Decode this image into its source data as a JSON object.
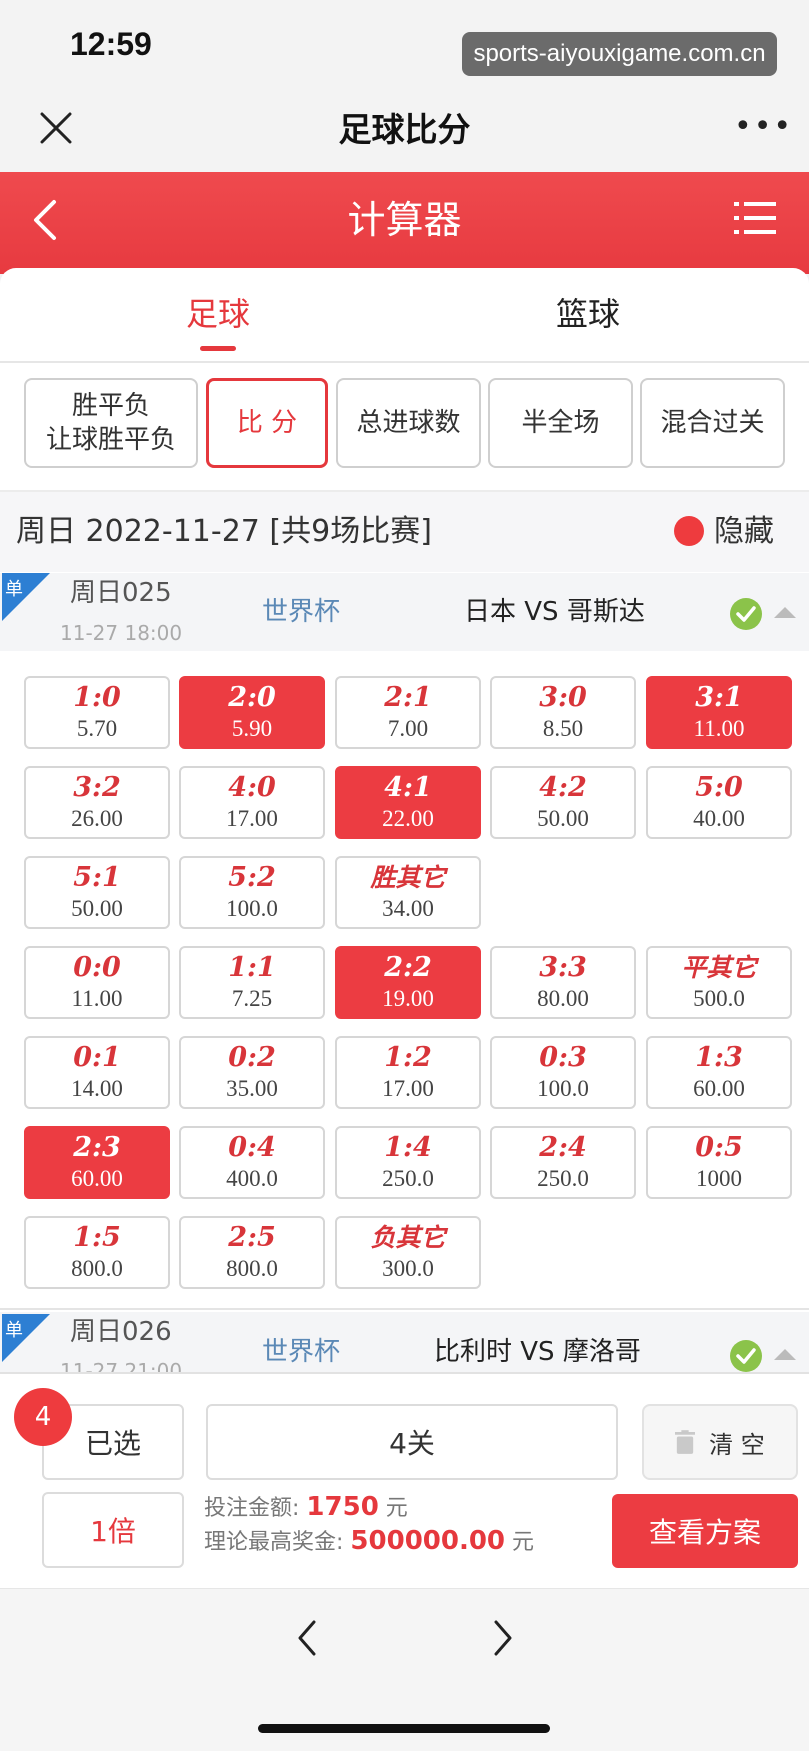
{
  "status": {
    "time": "12:59",
    "watermark": "sports-aiyouxigame.com.cn"
  },
  "wechat": {
    "title": "足球比分"
  },
  "header": {
    "title": "计算器"
  },
  "sport_tabs": [
    {
      "label": "足球",
      "active": true
    },
    {
      "label": "篮球",
      "active": false
    }
  ],
  "play_types": [
    {
      "label": "胜平负",
      "label2": "让球胜平负",
      "selected": false
    },
    {
      "label": "比 分",
      "selected": true
    },
    {
      "label": "总进球数",
      "selected": false
    },
    {
      "label": "半全场",
      "selected": false
    },
    {
      "label": "混合过关",
      "selected": false
    }
  ],
  "date_bar": {
    "label": "周日 2022-11-27 [共9场比赛]",
    "hide_label": "隐藏"
  },
  "matches": [
    {
      "badge": "单",
      "code": "周日025",
      "time": "11-27 18:00",
      "league": "世界杯",
      "teams": "日本 VS 哥斯达"
    },
    {
      "badge": "单",
      "code": "周日026",
      "time": "11-27 21:00",
      "league": "世界杯",
      "teams": "比利时 VS 摩洛哥"
    }
  ],
  "score_rows": [
    [
      {
        "s": "1:0",
        "o": "5.70",
        "sel": false
      },
      {
        "s": "2:0",
        "o": "5.90",
        "sel": true
      },
      {
        "s": "2:1",
        "o": "7.00",
        "sel": false
      },
      {
        "s": "3:0",
        "o": "8.50",
        "sel": false
      },
      {
        "s": "3:1",
        "o": "11.00",
        "sel": true
      }
    ],
    [
      {
        "s": "3:2",
        "o": "26.00",
        "sel": false
      },
      {
        "s": "4:0",
        "o": "17.00",
        "sel": false
      },
      {
        "s": "4:1",
        "o": "22.00",
        "sel": true
      },
      {
        "s": "4:2",
        "o": "50.00",
        "sel": false
      },
      {
        "s": "5:0",
        "o": "40.00",
        "sel": false
      }
    ],
    [
      {
        "s": "5:1",
        "o": "50.00",
        "sel": false
      },
      {
        "s": "5:2",
        "o": "100.0",
        "sel": false
      },
      {
        "s": "胜其它",
        "o": "34.00",
        "sel": false
      }
    ],
    [
      {
        "s": "0:0",
        "o": "11.00",
        "sel": false
      },
      {
        "s": "1:1",
        "o": "7.25",
        "sel": false
      },
      {
        "s": "2:2",
        "o": "19.00",
        "sel": true
      },
      {
        "s": "3:3",
        "o": "80.00",
        "sel": false
      },
      {
        "s": "平其它",
        "o": "500.0",
        "sel": false
      }
    ],
    [
      {
        "s": "0:1",
        "o": "14.00",
        "sel": false
      },
      {
        "s": "0:2",
        "o": "35.00",
        "sel": false
      },
      {
        "s": "1:2",
        "o": "17.00",
        "sel": false
      },
      {
        "s": "0:3",
        "o": "100.0",
        "sel": false
      },
      {
        "s": "1:3",
        "o": "60.00",
        "sel": false
      }
    ],
    [
      {
        "s": "2:3",
        "o": "60.00",
        "sel": true
      },
      {
        "s": "0:4",
        "o": "400.0",
        "sel": false
      },
      {
        "s": "1:4",
        "o": "250.0",
        "sel": false
      },
      {
        "s": "2:4",
        "o": "250.0",
        "sel": false
      },
      {
        "s": "0:5",
        "o": "1000",
        "sel": false
      }
    ],
    [
      {
        "s": "1:5",
        "o": "800.0",
        "sel": false
      },
      {
        "s": "2:5",
        "o": "800.0",
        "sel": false
      },
      {
        "s": "负其它",
        "o": "300.0",
        "sel": false
      }
    ]
  ],
  "bottom": {
    "selected_count": "4",
    "selected_label": "已选",
    "pass_label": "4关",
    "clear_label": "清 空",
    "multiple_label": "1倍",
    "bet_amount_label": "投注金额:",
    "bet_amount": "1750",
    "bet_unit": "元",
    "max_prize_label": "理论最高奖金:",
    "max_prize": "500000.00",
    "prize_unit": "元",
    "scheme_button": "查看方案"
  },
  "colors": {
    "accent": "#ec3c42",
    "league": "#5b89b6",
    "check": "#8bc34a"
  }
}
